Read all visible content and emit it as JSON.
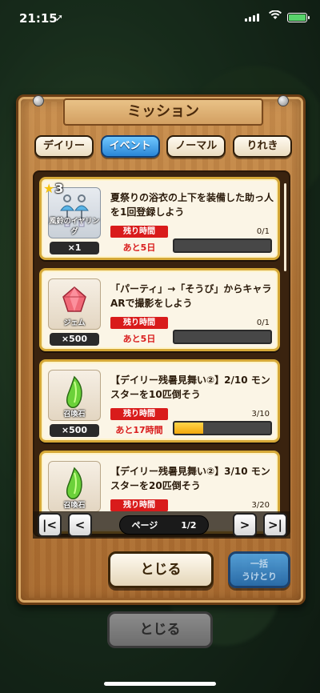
{
  "status_bar": {
    "time": "21:15",
    "location_glyph": "➚"
  },
  "panel": {
    "title": "ミッション"
  },
  "tabs": [
    {
      "label": "デイリー",
      "active": false
    },
    {
      "label": "イベント",
      "active": true
    },
    {
      "label": "ノーマル",
      "active": false
    },
    {
      "label": "りれき",
      "active": false
    }
  ],
  "missions": [
    {
      "stars": "3",
      "item_name": "風鈴のイヤリング",
      "quantity": "×1",
      "description": "夏祭りの浴衣の上下を装備した助っ人を1回登録しよう",
      "progress_text": "0/1",
      "progress": 0,
      "remaining_label": "残り時間",
      "time_left": "あと5日"
    },
    {
      "stars": "",
      "item_name": "ジェム",
      "quantity": "×500",
      "description": "「パーティ」→「そうび」からキャラARで撮影をしよう",
      "progress_text": "0/1",
      "progress": 0,
      "remaining_label": "残り時間",
      "time_left": "あと5日"
    },
    {
      "stars": "",
      "item_name": "召喚石",
      "quantity": "×500",
      "description": "【デイリー残暑見舞い②】2/10 モンスターを10匹倒そう",
      "progress_text": "3/10",
      "progress": 0.3,
      "remaining_label": "残り時間",
      "time_left": "あと17時間"
    },
    {
      "stars": "",
      "item_name": "召喚石",
      "quantity": "",
      "description": "【デイリー残暑見舞い②】3/10 モンスターを20匹倒そう",
      "progress_text": "3/20",
      "progress": 0.15,
      "remaining_label": "残り時間",
      "time_left": ""
    }
  ],
  "pager": {
    "label": "ページ",
    "page": "1/2",
    "first": "|<",
    "prev": "<",
    "next": ">",
    "last": ">|"
  },
  "buttons": {
    "close": "とじる",
    "bulk_line1": "一括",
    "bulk_line2": "うけとり",
    "back_close": "とじる"
  },
  "colors": {
    "accent_blue": "#2a86d6",
    "gold_border": "#d6a938",
    "timer_red": "#d91b1b",
    "progress_fill": "#f2a80d"
  }
}
